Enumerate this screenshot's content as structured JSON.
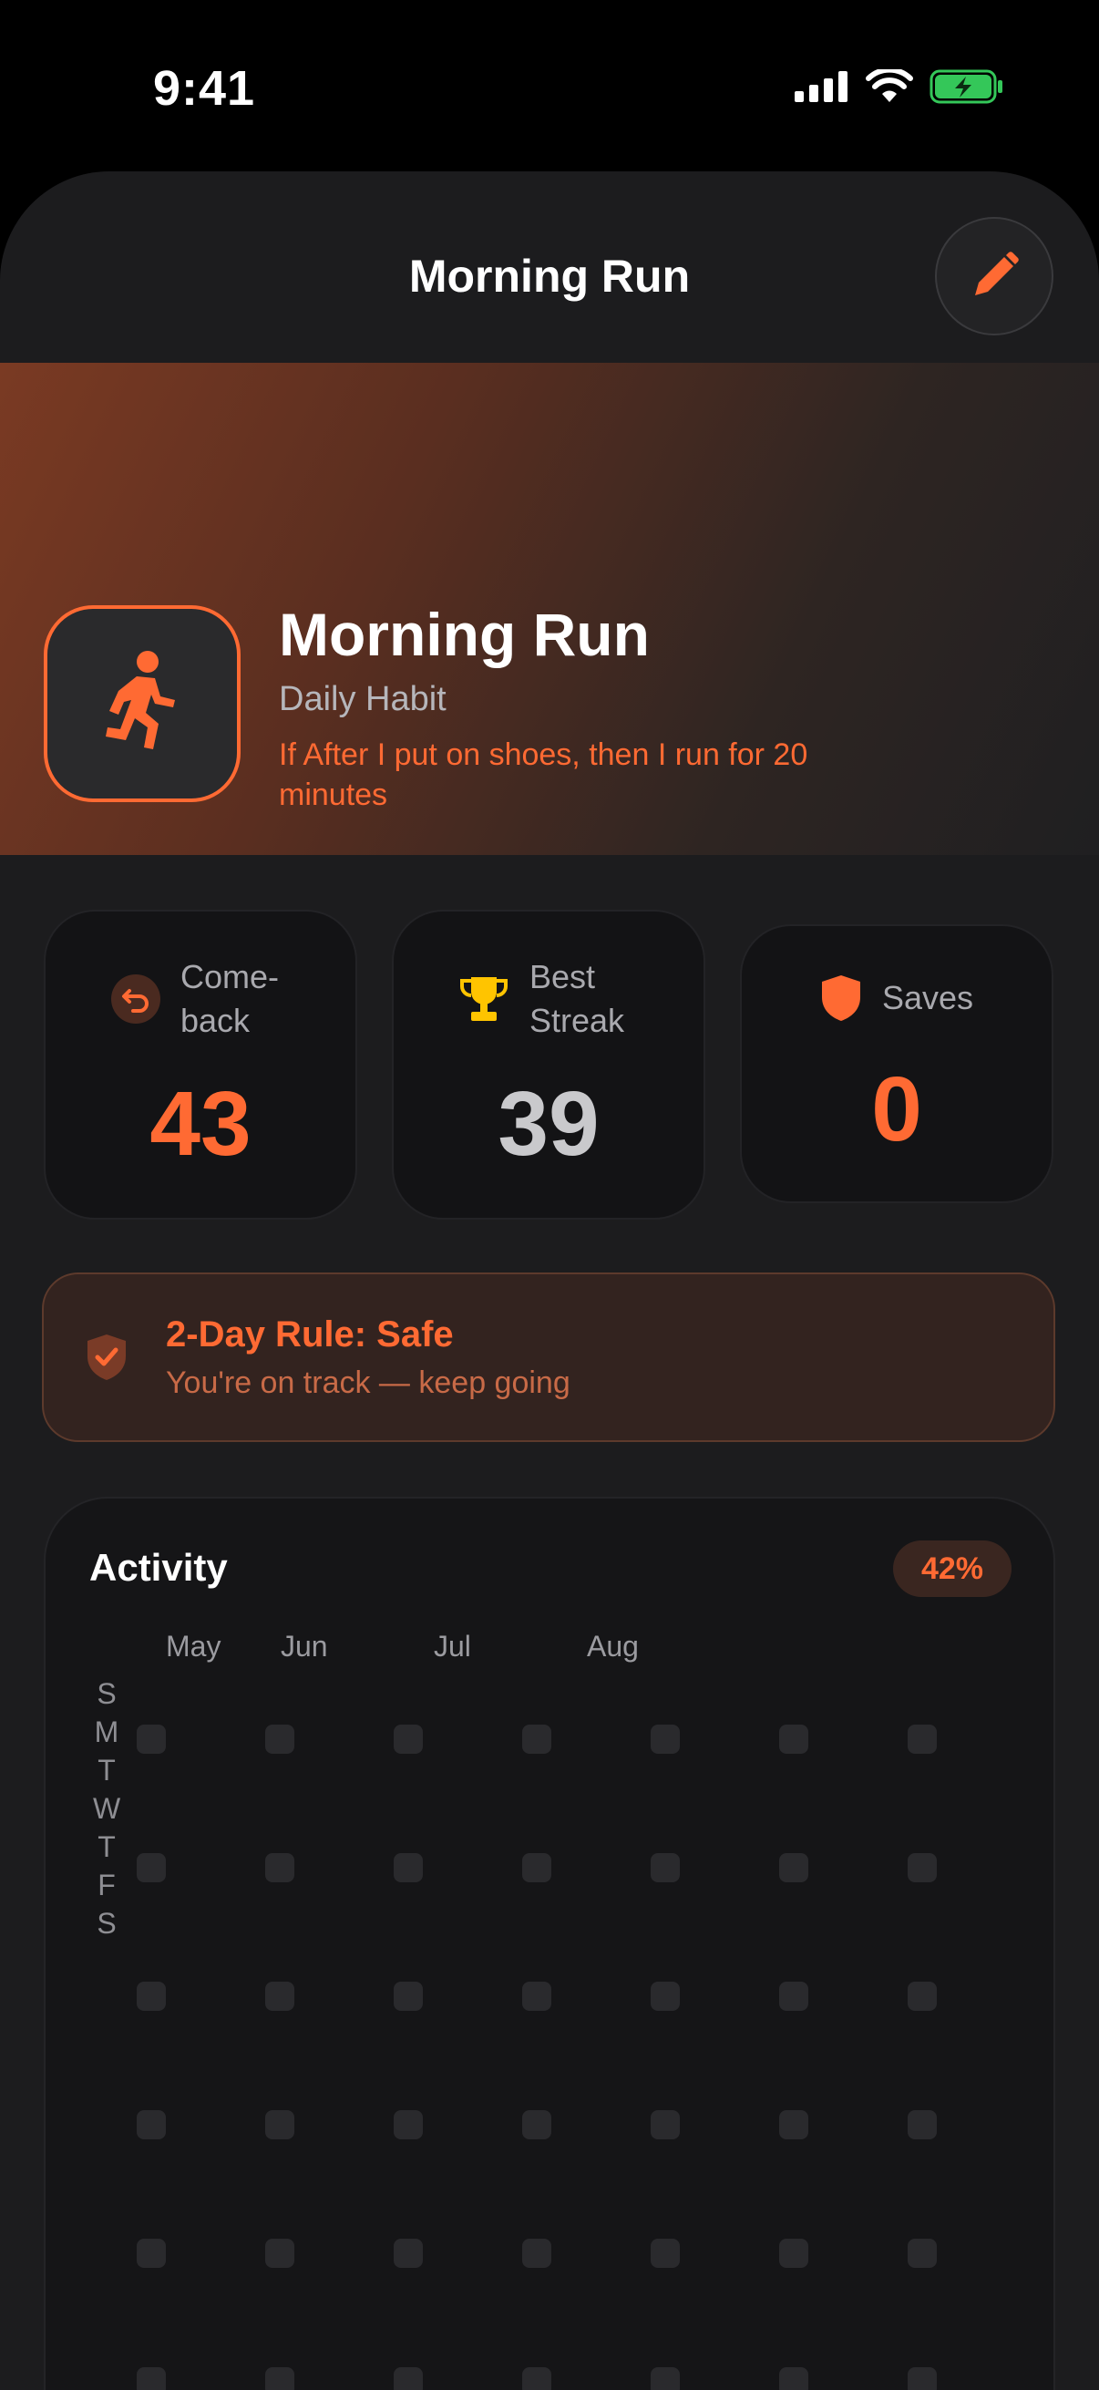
{
  "status_bar": {
    "time": "9:41",
    "icons": [
      "signal-icon",
      "wifi-icon",
      "battery-charging-icon"
    ]
  },
  "nav": {
    "title": "Morning Run",
    "edit_icon": "pencil-icon"
  },
  "hero": {
    "icon": "running-person-icon",
    "title": "Morning Run",
    "subtitle": "Daily Habit",
    "plan": "If After I put on shoes, then I run for 20 minutes"
  },
  "stats": {
    "comeback": {
      "icon": "undo-arrow-icon",
      "label": "Come-back",
      "value": "43"
    },
    "best_streak": {
      "icon": "trophy-icon",
      "label": "Best Streak",
      "value": "39"
    },
    "saves": {
      "icon": "shield-icon",
      "label": "Saves",
      "value": "0"
    }
  },
  "rule": {
    "icon": "shield-check-icon",
    "title": "2-Day Rule: Safe",
    "subtitle": "You're on track — keep going"
  },
  "activity": {
    "title": "Activity",
    "percent": "42%",
    "months": [
      "May",
      "Jun",
      "Jul",
      "Aug"
    ],
    "days": [
      "S",
      "M",
      "T",
      "W",
      "T",
      "F",
      "S"
    ]
  },
  "colors": {
    "accent": "#ff6a33",
    "background": "#1c1c1e",
    "card": "#131315",
    "trophy": "#ffc400",
    "battery": "#34c759"
  }
}
